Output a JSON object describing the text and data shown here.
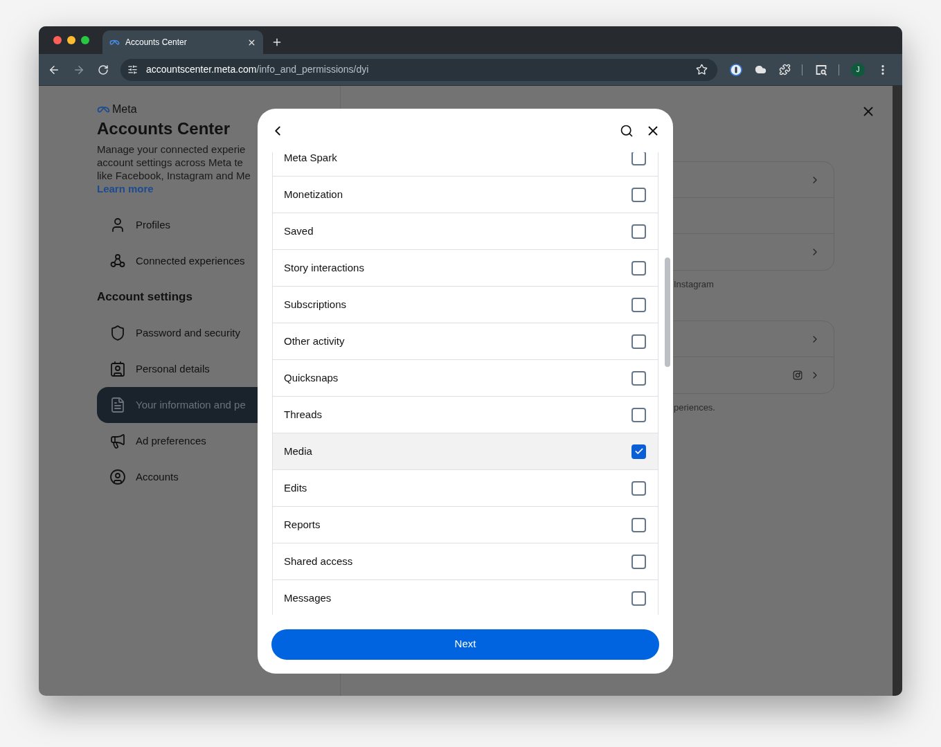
{
  "browser": {
    "tab": {
      "title": "Accounts Center"
    },
    "url": {
      "host": "accountscenter.meta.com",
      "path": "/info_and_permissions/dyi"
    },
    "profile_initial": "J"
  },
  "sidebar": {
    "logo": "Meta",
    "title": "Accounts Center",
    "description_lines": [
      "Manage your connected experie",
      "account settings across Meta te",
      "like Facebook, Instagram and Me"
    ],
    "learn_more": "Learn more",
    "top_items": [
      {
        "label": "Profiles",
        "kind": "person",
        "selected": false
      },
      {
        "label": "Connected experiences",
        "kind": "connected",
        "selected": false
      }
    ],
    "section": "Account settings",
    "items": [
      {
        "label": "Password and security",
        "kind": "shield",
        "selected": false
      },
      {
        "label": "Personal details",
        "kind": "badge",
        "selected": false
      },
      {
        "label": "Your information and pe",
        "kind": "document",
        "selected": true
      },
      {
        "label": "Ad preferences",
        "kind": "megaphone",
        "selected": false
      },
      {
        "label": "Accounts",
        "kind": "account",
        "selected": false
      }
    ]
  },
  "background_panel": {
    "groups": [
      {
        "rows": [
          {
            "kind": "chevron"
          },
          {
            "kind": "empty"
          },
          {
            "kind": "chevron"
          }
        ],
        "caption": "Instagram"
      },
      {
        "rows": [
          {
            "kind": "chevron"
          },
          {
            "kind": "instagram"
          }
        ],
        "caption": "periences."
      }
    ]
  },
  "modal": {
    "items": [
      {
        "label": "Meta Spark",
        "checked": false
      },
      {
        "label": "Monetization",
        "checked": false
      },
      {
        "label": "Saved",
        "checked": false
      },
      {
        "label": "Story interactions",
        "checked": false
      },
      {
        "label": "Subscriptions",
        "checked": false
      },
      {
        "label": "Other activity",
        "checked": false
      },
      {
        "label": "Quicksnaps",
        "checked": false
      },
      {
        "label": "Threads",
        "checked": false
      },
      {
        "label": "Media",
        "checked": true
      },
      {
        "label": "Edits",
        "checked": false
      },
      {
        "label": "Reports",
        "checked": false
      },
      {
        "label": "Shared access",
        "checked": false
      },
      {
        "label": "Messages",
        "checked": false
      }
    ],
    "button": "Next"
  }
}
